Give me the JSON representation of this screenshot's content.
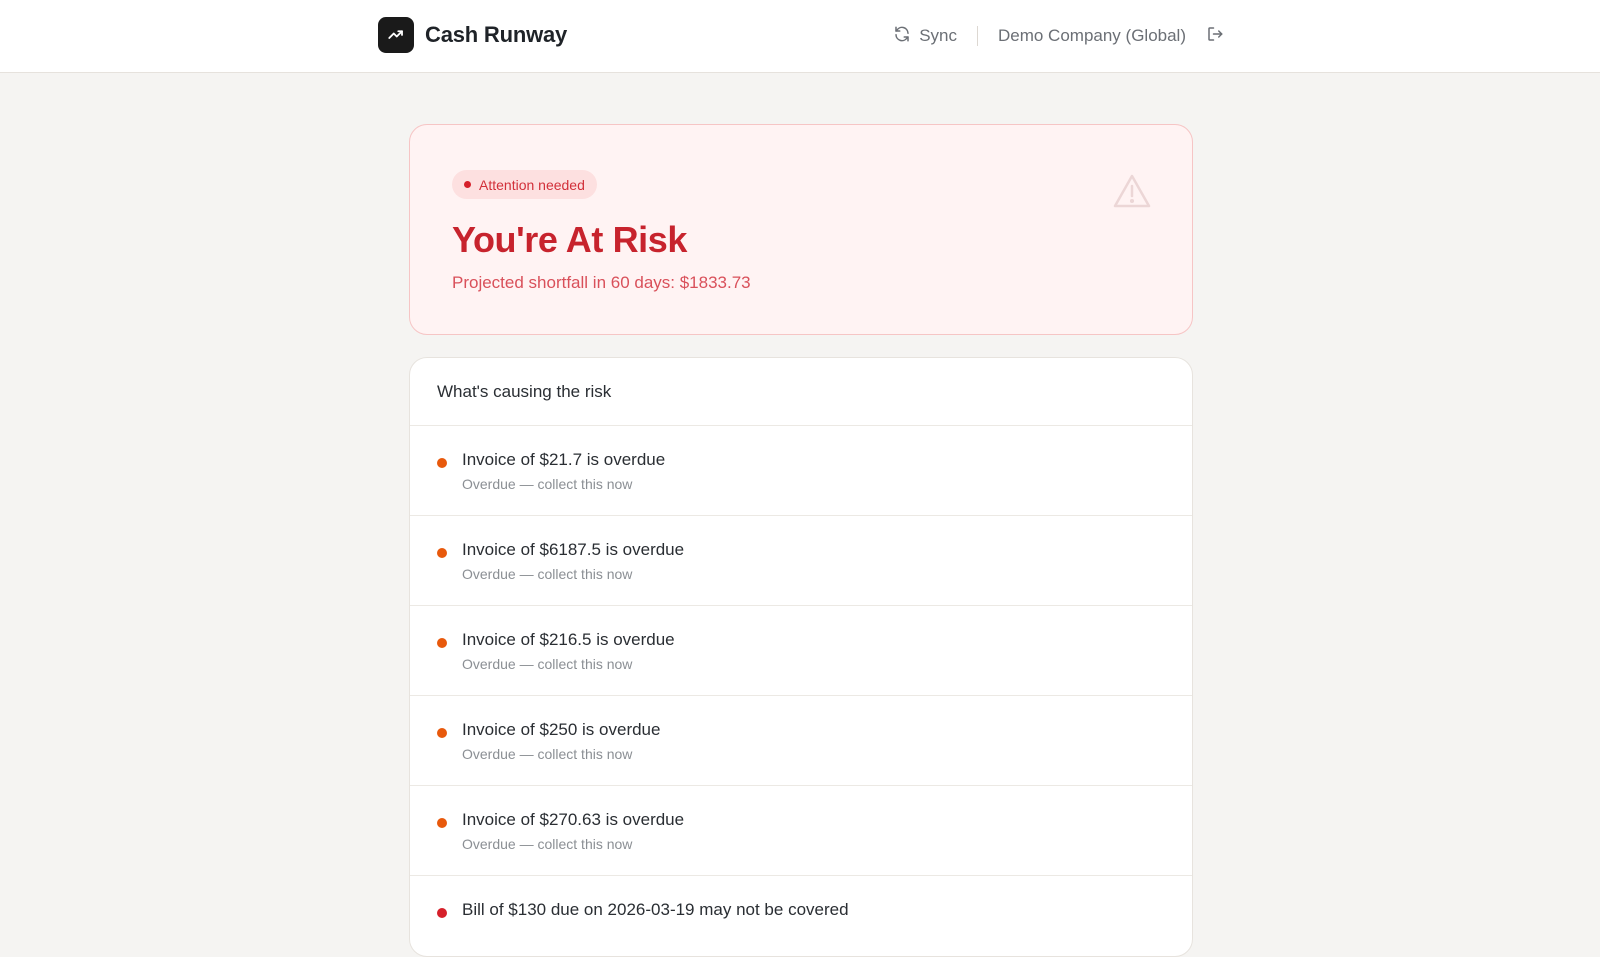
{
  "header": {
    "app_title": "Cash Runway",
    "logo_icon": "trend-up-icon",
    "sync_label": "Sync",
    "company_label": "Demo Company (Global)",
    "logout_icon": "logout-icon"
  },
  "risk": {
    "badge_label": "Attention needed",
    "title": "You're At Risk",
    "subtitle": "Projected shortfall in 60 days: $1833.73",
    "icon": "warning-triangle-icon",
    "colors": {
      "accent": "#c7232d",
      "background": "#fff3f3",
      "border": "#f6c5c5"
    }
  },
  "causes": {
    "header": "What's causing the risk",
    "items": [
      {
        "title": "Invoice of $21.7 is overdue",
        "subtitle": "Overdue — collect this now",
        "dot_color": "#e8590c"
      },
      {
        "title": "Invoice of $6187.5 is overdue",
        "subtitle": "Overdue — collect this now",
        "dot_color": "#e8590c"
      },
      {
        "title": "Invoice of $216.5 is overdue",
        "subtitle": "Overdue — collect this now",
        "dot_color": "#e8590c"
      },
      {
        "title": "Invoice of $250 is overdue",
        "subtitle": "Overdue — collect this now",
        "dot_color": "#e8590c"
      },
      {
        "title": "Invoice of $270.63 is overdue",
        "subtitle": "Overdue — collect this now",
        "dot_color": "#e8590c"
      },
      {
        "title": "Bill of $130 due on 2026-03-19 may not be covered",
        "subtitle": "",
        "dot_color": "#d6202a"
      }
    ]
  }
}
